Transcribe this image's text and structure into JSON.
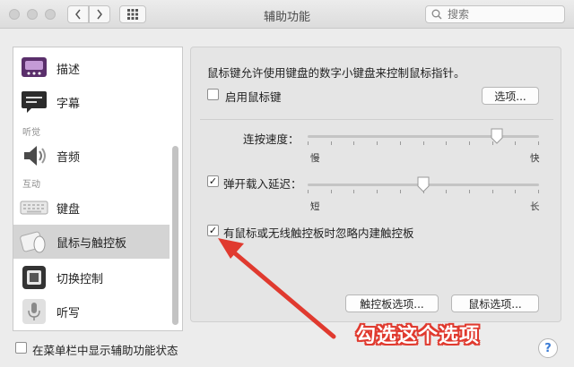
{
  "window": {
    "title": "辅助功能"
  },
  "search": {
    "placeholder": "搜索"
  },
  "sidebar": {
    "sections": {
      "hearing": "听觉",
      "interaction": "互动"
    },
    "items": [
      {
        "label": "描述",
        "icon": "description-icon"
      },
      {
        "label": "字幕",
        "icon": "captions-icon"
      },
      {
        "label": "音频",
        "icon": "speaker-icon"
      },
      {
        "label": "键盘",
        "icon": "keyboard-icon"
      },
      {
        "label": "鼠标与触控板",
        "icon": "mouse-trackpad-icon",
        "selected": true
      },
      {
        "label": "切换控制",
        "icon": "switch-control-icon"
      },
      {
        "label": "听写",
        "icon": "microphone-icon"
      }
    ]
  },
  "main": {
    "description": "鼠标键允许使用键盘的数字小键盘来控制鼠标指针。",
    "enable_mouse_keys": {
      "label": "启用鼠标键",
      "checked": false
    },
    "options_button": "选项...",
    "double_click_speed": {
      "label": "连按速度：",
      "min_label": "慢",
      "max_label": "快",
      "value": 0.84
    },
    "spring_loading": {
      "label": "弹开载入延迟：",
      "checked": true,
      "min_label": "短",
      "max_label": "长",
      "value": 0.5
    },
    "ignore_trackpad": {
      "label": "有鼠标或无线触控板时忽略内建触控板",
      "checked": true
    },
    "trackpad_options_button": "触控板选项...",
    "mouse_options_button": "鼠标选项..."
  },
  "footer": {
    "show_in_menubar": {
      "label": "在菜单栏中显示辅助功能状态",
      "checked": false
    },
    "help": "?"
  },
  "annotation": {
    "text": "勾选这个选项",
    "color": "#e03a2f"
  },
  "check_mark": "✓"
}
